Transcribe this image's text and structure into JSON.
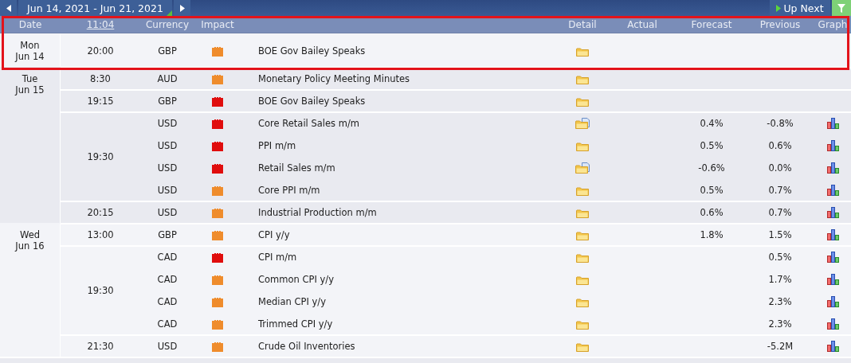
{
  "nav": {
    "range": "Jun 14, 2021 - Jun 21, 2021",
    "up_next": "Up Next"
  },
  "columns": [
    {
      "label": "Date",
      "link": false
    },
    {
      "label": "11:04",
      "link": true
    },
    {
      "label": "Currency",
      "link": false
    },
    {
      "label": "Impact",
      "link": false
    },
    {
      "label": "Detail",
      "link": false
    },
    {
      "label": "Actual",
      "link": false
    },
    {
      "label": "Forecast",
      "link": false
    },
    {
      "label": "Previous",
      "link": false
    },
    {
      "label": "Graph",
      "link": false
    }
  ],
  "highlight_frame": true,
  "days": [
    {
      "day": "Mon",
      "date": "Jun 14",
      "groups": [
        {
          "time": "20:00",
          "events": [
            {
              "currency": "GBP",
              "color": "#ef8c2c",
              "event": "BOE Gov Bailey Speaks",
              "detail": {
                "kind": "folder"
              },
              "graph": false
            }
          ]
        }
      ]
    },
    {
      "day": "Tue",
      "date": "Jun 15",
      "groups": [
        {
          "time": "8:30",
          "events": [
            {
              "currency": "AUD",
              "color": "#ef8c2c",
              "event": "Monetary Policy Meeting Minutes",
              "detail": {
                "kind": "folder"
              },
              "graph": false
            }
          ]
        },
        {
          "time": "19:15",
          "events": [
            {
              "currency": "GBP",
              "color": "#e00d0d",
              "event": "BOE Gov Bailey Speaks",
              "detail": {
                "kind": "folder"
              },
              "graph": false
            }
          ]
        },
        {
          "time": "19:30",
          "events": [
            {
              "currency": "USD",
              "color": "#e00d0d",
              "event": "Core Retail Sales m/m",
              "detail": {
                "kind": "folder_doc"
              },
              "forecast": "0.4%",
              "previous": "-0.8%",
              "graph": true
            },
            {
              "currency": "USD",
              "color": "#e00d0d",
              "event": "PPI m/m",
              "detail": {
                "kind": "folder"
              },
              "forecast": "0.5%",
              "previous": "0.6%",
              "graph": true
            },
            {
              "currency": "USD",
              "color": "#e00d0d",
              "event": "Retail Sales m/m",
              "detail": {
                "kind": "folder_doc"
              },
              "forecast": "-0.6%",
              "previous": "0.0%",
              "graph": true
            },
            {
              "currency": "USD",
              "color": "#ef8c2c",
              "event": "Core PPI m/m",
              "detail": {
                "kind": "folder"
              },
              "forecast": "0.5%",
              "previous": "0.7%",
              "graph": true
            }
          ]
        },
        {
          "time": "20:15",
          "events": [
            {
              "currency": "USD",
              "color": "#ef8c2c",
              "event": "Industrial Production m/m",
              "detail": {
                "kind": "folder"
              },
              "forecast": "0.6%",
              "previous": "0.7%",
              "graph": true
            }
          ]
        }
      ]
    },
    {
      "day": "Wed",
      "date": "Jun 16",
      "groups": [
        {
          "time": "13:00",
          "events": [
            {
              "currency": "GBP",
              "color": "#ef8c2c",
              "event": "CPI y/y",
              "detail": {
                "kind": "folder"
              },
              "forecast": "1.8%",
              "previous": "1.5%",
              "graph": true
            }
          ]
        },
        {
          "time": "19:30",
          "events": [
            {
              "currency": "CAD",
              "color": "#e00d0d",
              "event": "CPI m/m",
              "detail": {
                "kind": "folder"
              },
              "previous": "0.5%",
              "graph": true
            },
            {
              "currency": "CAD",
              "color": "#ef8c2c",
              "event": "Common CPI y/y",
              "detail": {
                "kind": "folder"
              },
              "previous": "1.7%",
              "graph": true
            },
            {
              "currency": "CAD",
              "color": "#ef8c2c",
              "event": "Median CPI y/y",
              "detail": {
                "kind": "folder"
              },
              "previous": "2.3%",
              "graph": true
            },
            {
              "currency": "CAD",
              "color": "#ef8c2c",
              "event": "Trimmed CPI y/y",
              "detail": {
                "kind": "folder"
              },
              "previous": "2.3%",
              "graph": true
            }
          ]
        },
        {
          "time": "21:30",
          "events": [
            {
              "currency": "USD",
              "color": "#ef8c2c",
              "event": "Crude Oil Inventories",
              "detail": {
                "kind": "folder"
              },
              "previous": "-5.2M",
              "graph": true
            }
          ]
        }
      ]
    }
  ]
}
